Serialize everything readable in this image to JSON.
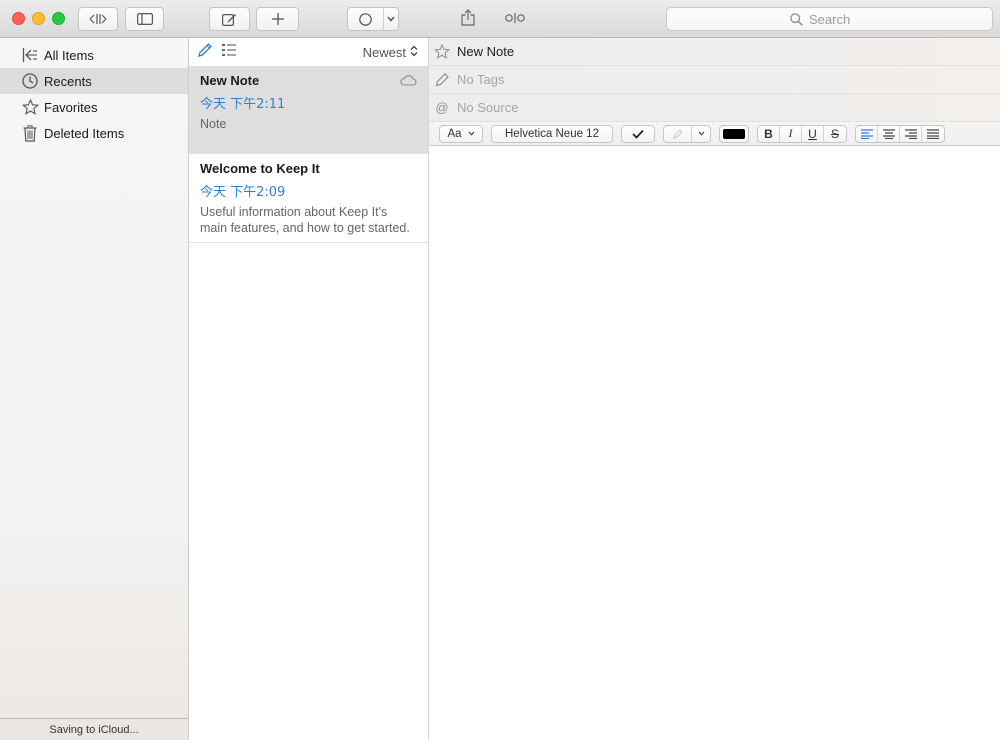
{
  "toolbar": {
    "search_placeholder": "Search"
  },
  "sidebar": {
    "items": [
      {
        "label": "All Items",
        "icon": "all-items-icon",
        "selected": false
      },
      {
        "label": "Recents",
        "icon": "clock-icon",
        "selected": true
      },
      {
        "label": "Favorites",
        "icon": "star-icon",
        "selected": false
      },
      {
        "label": "Deleted Items",
        "icon": "trash-icon",
        "selected": false
      }
    ],
    "footer": "Saving to iCloud..."
  },
  "notes_list": {
    "sort_label": "Newest",
    "notes": [
      {
        "title": "New Note",
        "date": "今天 下午2:11",
        "body": "Note",
        "selected": true
      },
      {
        "title": "Welcome to Keep It",
        "date": "今天 下午2:09",
        "body": "Useful information about Keep It's main features, and how to get started.",
        "selected": false
      }
    ]
  },
  "editor": {
    "title": "New Note",
    "tags_placeholder": "No Tags",
    "source_placeholder": "No Source",
    "format": {
      "style_label": "Aa",
      "font_label": "Helvetica Neue 12",
      "bold": "B",
      "italic": "I",
      "underline": "U",
      "strike": "S",
      "text_color": "#000000"
    }
  },
  "colors": {
    "accent": "#2f7fd9",
    "selected_row": "#dedede"
  }
}
